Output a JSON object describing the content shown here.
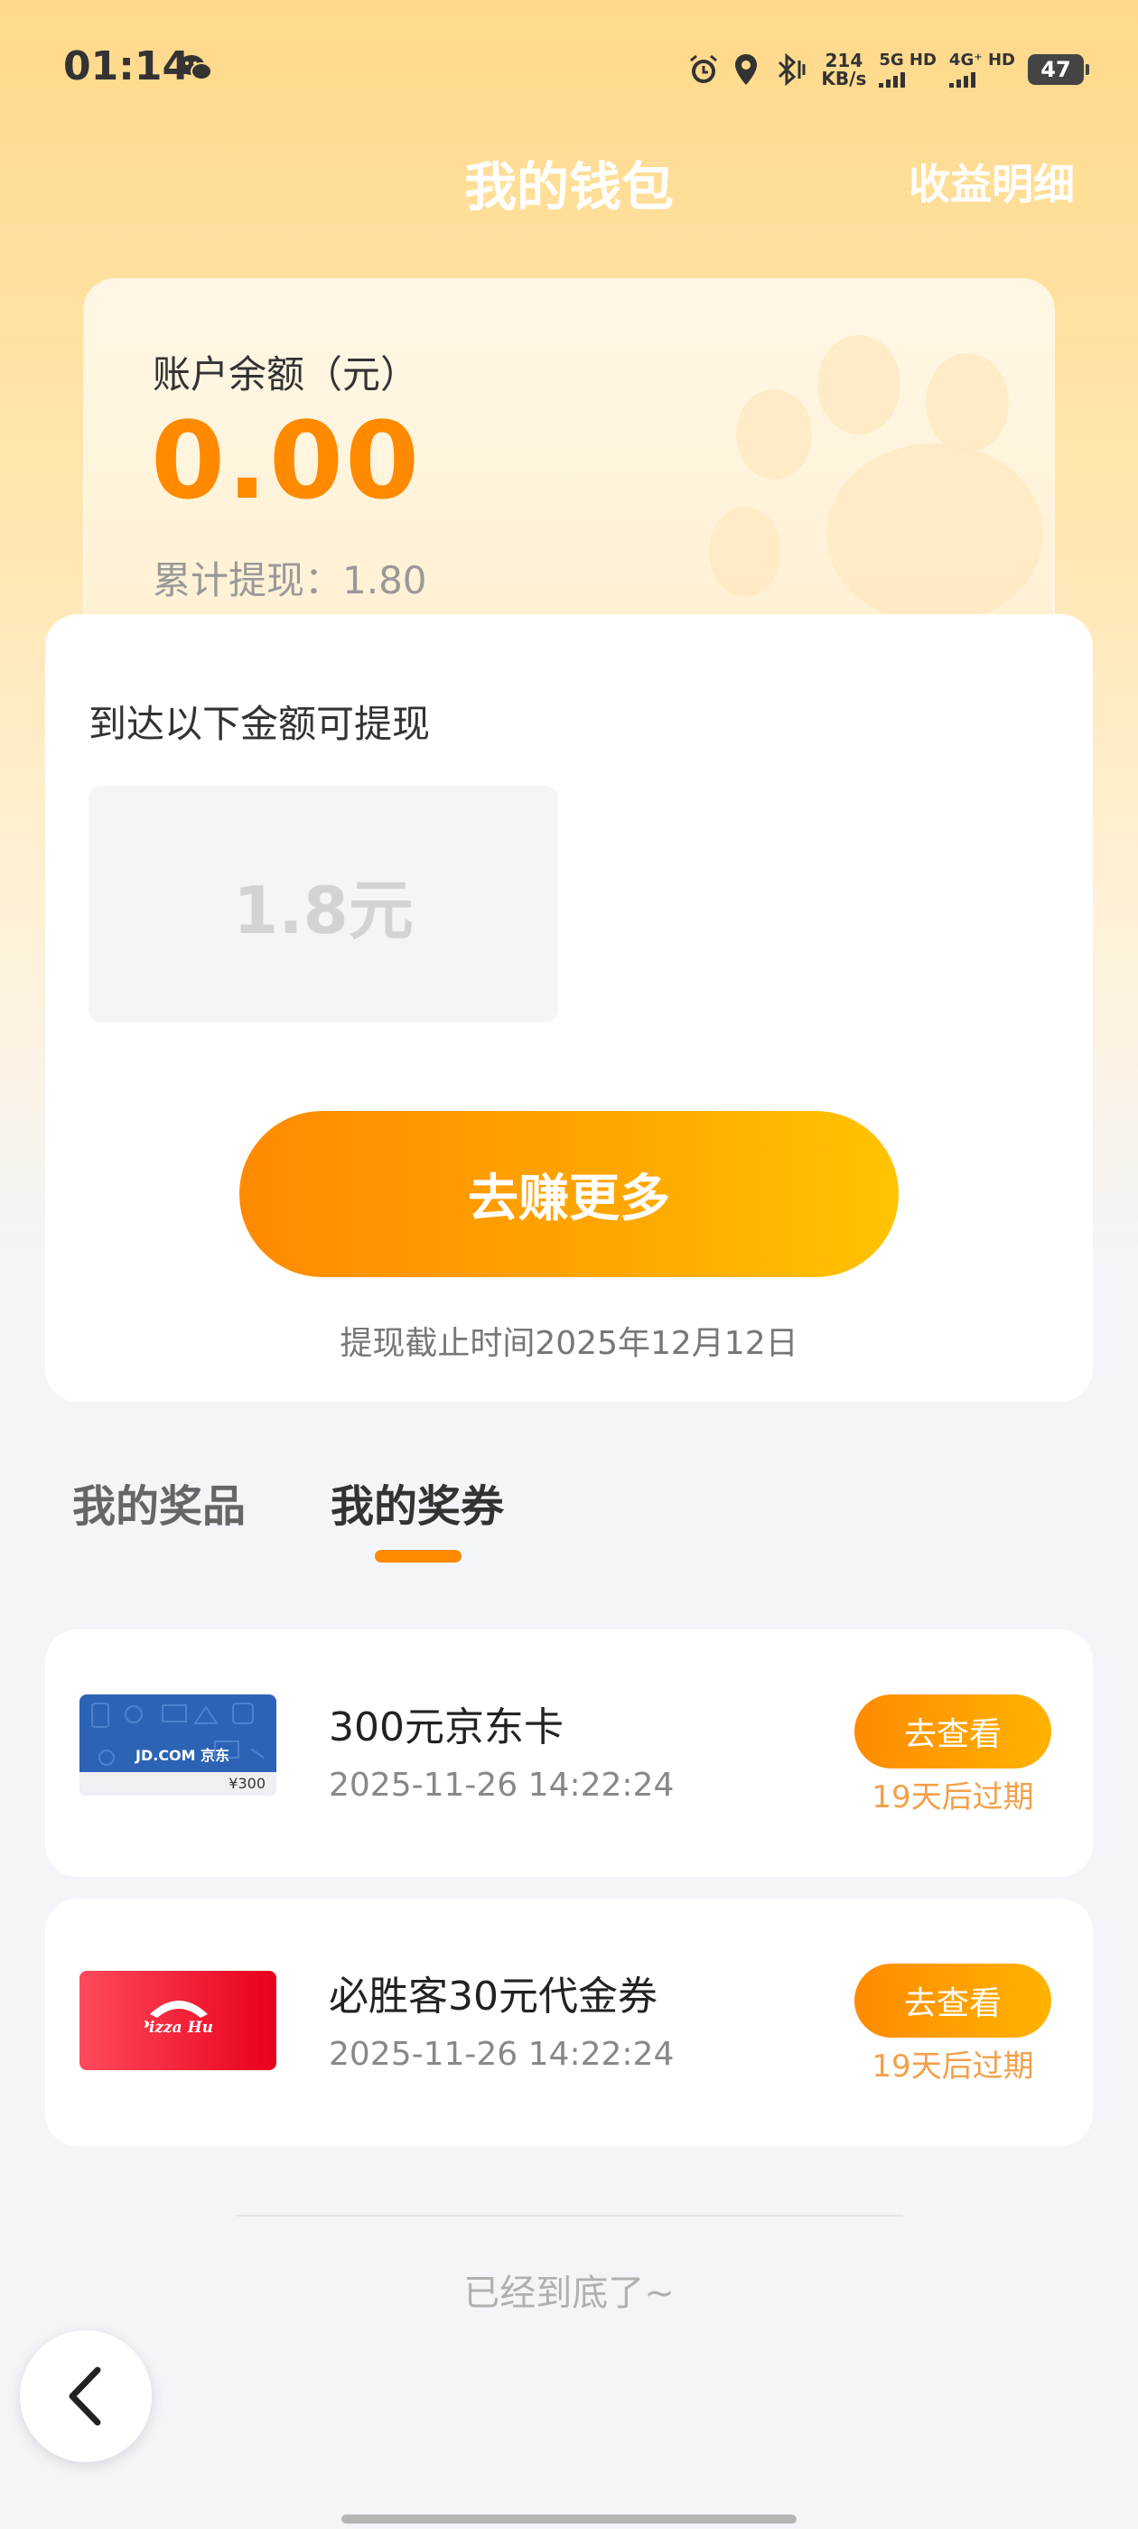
{
  "status_bar": {
    "time": "01:14",
    "net_speed_value": "214",
    "net_speed_unit": "KB/s",
    "sim1_label": "5G HD",
    "sim2_label": "4G⁺ HD",
    "battery": "47",
    "icons": [
      "wechat-icon",
      "alarm-icon",
      "location-icon",
      "bluetooth-icon"
    ]
  },
  "header": {
    "title": "我的钱包",
    "right_link": "收益明细"
  },
  "balance": {
    "label": "账户余额（元）",
    "value": "0.00",
    "withdrawn_label": "累计提现：",
    "withdrawn_value": "1.80"
  },
  "withdraw": {
    "title": "到达以下金额可提现",
    "amount": "1.8元",
    "button": "去赚更多",
    "deadline": "提现截止时间2025年12月12日"
  },
  "tabs": [
    {
      "label": "我的奖品",
      "active": false
    },
    {
      "label": "我的奖券",
      "active": true
    }
  ],
  "coupons": [
    {
      "name": "300元京东卡",
      "date": "2025-11-26 14:22:24",
      "button": "去查看",
      "expire": "19天后过期",
      "thumb_text": "JD.COM 京东",
      "thumb_value": "¥300"
    },
    {
      "name": "必胜客30元代金券",
      "date": "2025-11-26 14:22:24",
      "button": "去查看",
      "expire": "19天后过期",
      "thumb_text": "Pizza Hut"
    }
  ],
  "footer": {
    "end_text": "已经到底了~"
  },
  "colors": {
    "accent": "#ff8a00",
    "accent_light": "#ffc400",
    "expire": "#f2a04a"
  }
}
